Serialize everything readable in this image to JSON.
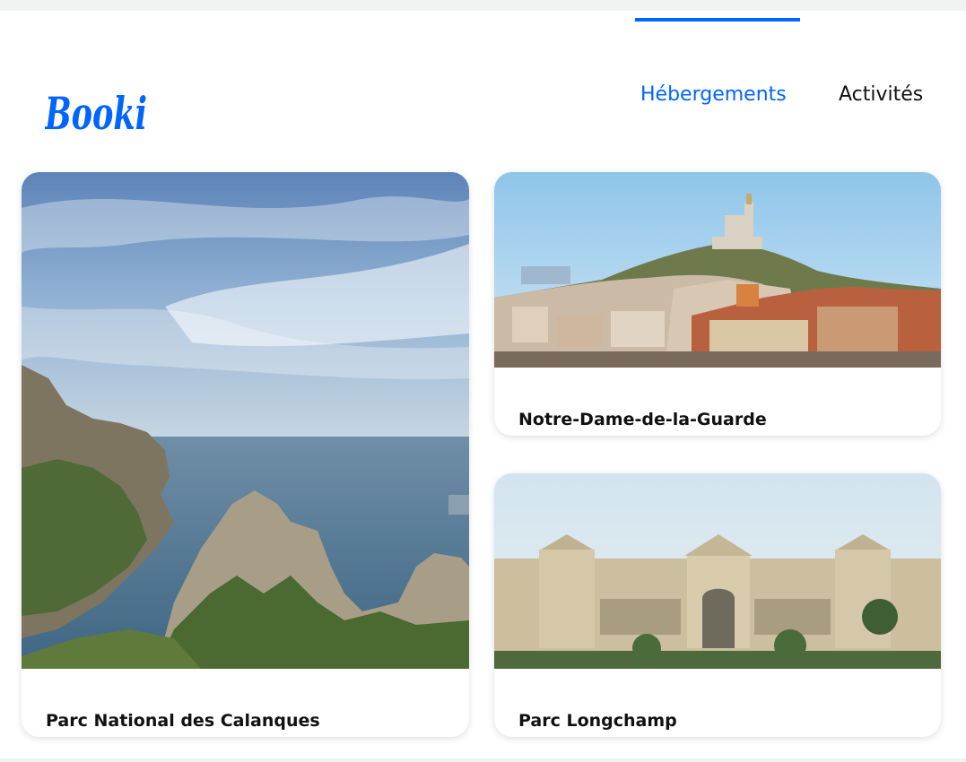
{
  "brand": {
    "logo_text": "Booki",
    "accent_color": "#0065fc"
  },
  "nav": {
    "items": [
      {
        "label": "Hébergements",
        "active": true
      },
      {
        "label": "Activités",
        "active": false
      }
    ]
  },
  "cards": [
    {
      "title": "Parc National des Calanques",
      "image": "calanques-cliffs-sea-photo"
    },
    {
      "title": "Notre-Dame-de-la-Guarde",
      "image": "notre-dame-de-la-garde-city-photo"
    },
    {
      "title": "Parc Longchamp",
      "image": "palais-longchamp-photo"
    }
  ]
}
